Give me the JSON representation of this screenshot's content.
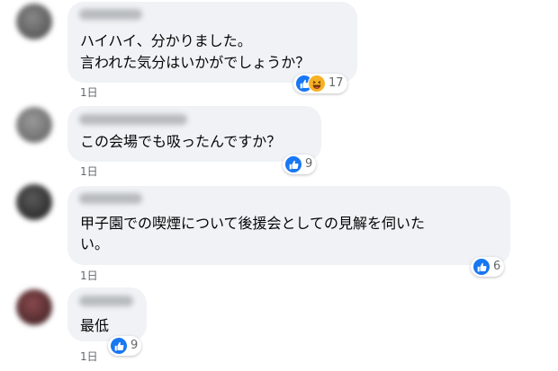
{
  "colors": {
    "bubble": "#f0f2f5",
    "like": "#1877f2",
    "haha": "#f7b125",
    "meta_text": "#65676b"
  },
  "comments": [
    {
      "lines": [
        "ハイハイ、分かりました。",
        "言われた気分はいかがでしょうか？"
      ],
      "time": "1日",
      "reactions": [
        "like-icon",
        "haha-icon"
      ],
      "reaction_count": "17"
    },
    {
      "lines": [
        "この会場でも吸ったんですか？"
      ],
      "time": "1日",
      "reactions": [
        "like-icon"
      ],
      "reaction_count": "9"
    },
    {
      "lines": [
        "甲子園での喫煙について後援会としての見解を伺いた",
        "い。"
      ],
      "time": "1日",
      "reactions": [
        "like-icon"
      ],
      "reaction_count": "6"
    },
    {
      "lines": [
        "最低"
      ],
      "time": "1日",
      "reactions": [
        "like-icon"
      ],
      "reaction_count": "9"
    }
  ]
}
